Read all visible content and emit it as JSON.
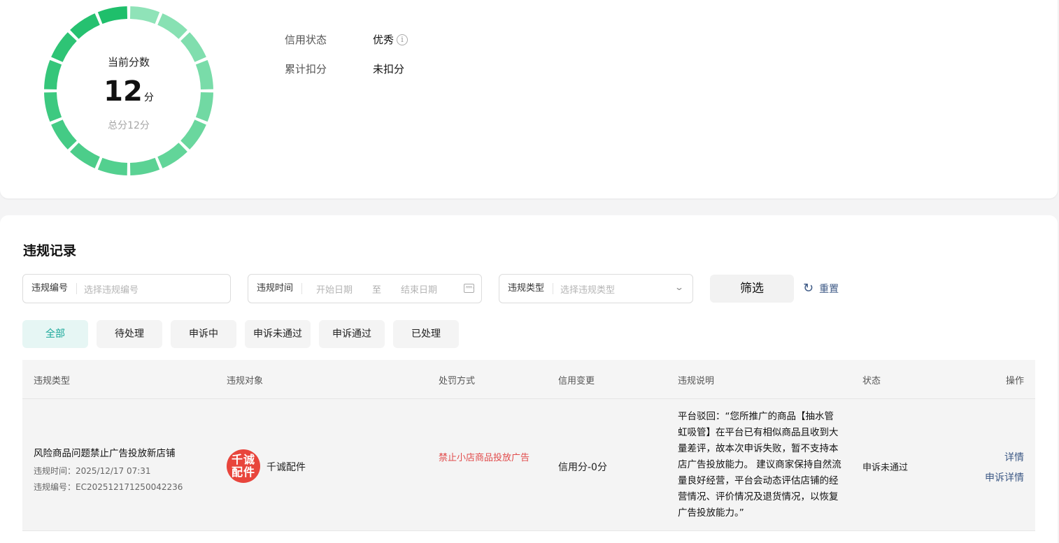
{
  "score": {
    "label": "当前分数",
    "value": "12",
    "unit": "分",
    "total": "总分12分",
    "fraction": 1.0,
    "ring_color_start": "#1fbf6b",
    "ring_color_end": "#8fe3b8"
  },
  "info": {
    "credit_status_label": "信用状态",
    "credit_status_value": "优秀",
    "deduction_label": "累计扣分",
    "deduction_value": "未扣分"
  },
  "section": {
    "title": "违规记录"
  },
  "filters": {
    "id_label": "违规编号",
    "id_placeholder": "选择违规编号",
    "time_label": "违规时间",
    "start_placeholder": "开始日期",
    "to": "至",
    "end_placeholder": "结束日期",
    "type_label": "违规类型",
    "type_placeholder": "选择违规类型",
    "filter_button": "筛选",
    "reset_button": "重置"
  },
  "tabs": [
    "全部",
    "待处理",
    "申诉中",
    "申诉未通过",
    "申诉通过",
    "已处理"
  ],
  "table": {
    "headers": [
      "违规类型",
      "违规对象",
      "处罚方式",
      "信用变更",
      "违规说明",
      "状态",
      "操作"
    ],
    "rows": [
      {
        "type": "风险商品问题禁止广告投放新店铺",
        "time": "违规时间：2025/12/17 07:31",
        "code": "违规编号：EC202512171250042236",
        "shop_logo_text": "千诚配件",
        "shop_name": "千诚配件",
        "penalty": "禁止小店商品投放广告",
        "credit_change": "信用分-0分",
        "description": "平台驳回：“您所推广的商品【抽水管虹吸管】在平台已有相似商品且收到大量差评，故本次申诉失败，暂不支持本店广告投放能力。 建议商家保持自然流量良好经营，平台会动态评估店铺的经营情况、评价情况及退货情况，以恢复广告投放能力。”",
        "status": "申诉未通过",
        "op_detail": "详情",
        "op_appeal_detail": "申诉详情"
      }
    ]
  }
}
